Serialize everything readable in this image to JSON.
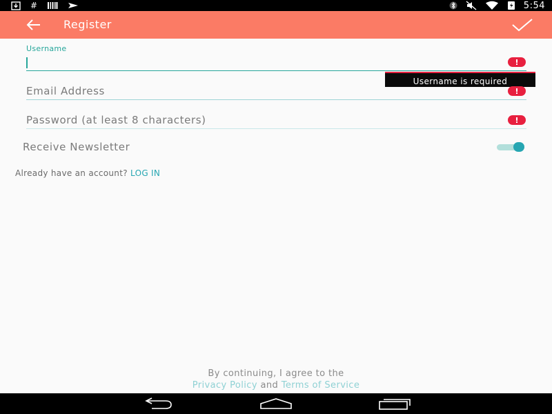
{
  "status_bar": {
    "left_icons": [
      "download-icon",
      "hashtag-icon",
      "barcode-icon",
      "send-icon"
    ],
    "right_icons": [
      "bluetooth-icon",
      "mute-icon",
      "wifi-icon",
      "battery-icon"
    ],
    "time": "5:54",
    "hash_glyph": "#"
  },
  "app_bar": {
    "title": "Register",
    "back_icon": "arrow-back-icon",
    "done_icon": "check-icon",
    "background_color": "#fb7b65"
  },
  "form": {
    "username": {
      "label": "Username",
      "value": ""
    },
    "email": {
      "placeholder": "Email Address"
    },
    "password": {
      "placeholder": "Password (at least 8 characters)"
    },
    "error_tooltip": "Username is required",
    "newsletter": {
      "label": "Receive Newsletter",
      "checked": true
    }
  },
  "login": {
    "prompt": "Already have an account?",
    "link": "LOG IN"
  },
  "terms": {
    "line1": "By continuing, I agree to the",
    "privacy_link": "Privacy Policy",
    "and": "and",
    "tos_link": "Terms of Service"
  },
  "colors": {
    "accent": "#26a6b2",
    "error": "#e8203f",
    "primary": "#fb7b65"
  }
}
